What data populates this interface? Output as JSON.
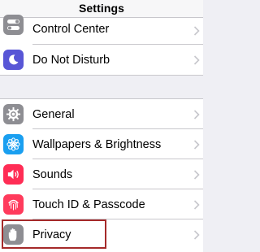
{
  "header": {
    "title": "Settings"
  },
  "group1": [
    {
      "label": "Control Center",
      "icon": "toggles-icon",
      "color": "#8e8e93"
    },
    {
      "label": "Do Not Disturb",
      "icon": "moon-icon",
      "color": "#5856d6"
    }
  ],
  "group2": [
    {
      "label": "General",
      "icon": "gear-icon",
      "color": "#8e8e93"
    },
    {
      "label": "Wallpapers & Brightness",
      "icon": "flower-icon",
      "color": "#1a9ff0"
    },
    {
      "label": "Sounds",
      "icon": "speaker-icon",
      "color": "#ff2d55"
    },
    {
      "label": "Touch ID & Passcode",
      "icon": "fingerprint-icon",
      "color": "#ff3b5c"
    },
    {
      "label": "Privacy",
      "icon": "hand-icon",
      "color": "#8e8e93"
    }
  ],
  "highlight_color": "#a52a2a"
}
